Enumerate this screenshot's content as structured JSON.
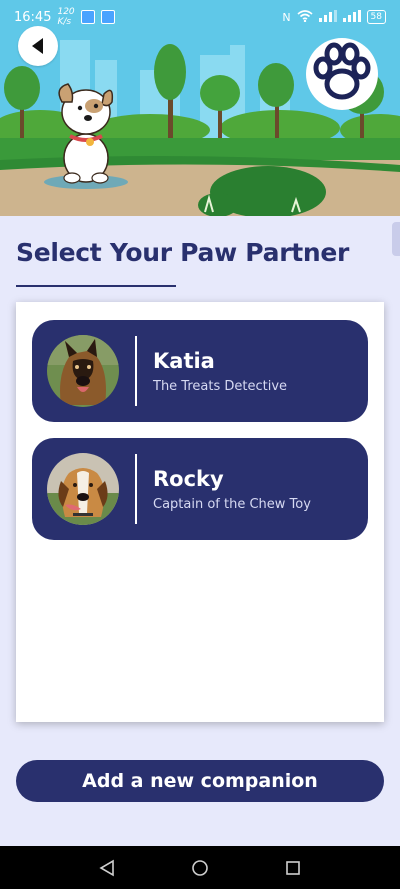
{
  "status_bar": {
    "time": "16:45",
    "speed": "120",
    "speed_unit": "K/s",
    "battery": "58"
  },
  "page": {
    "title": "Select Your Paw Partner"
  },
  "pets": [
    {
      "name": "Katia",
      "subtitle": "The Treats Detective"
    },
    {
      "name": "Rocky",
      "subtitle": "Captain of the Chew Toy"
    }
  ],
  "actions": {
    "add_label": "Add a new companion"
  },
  "colors": {
    "primary": "#29306e",
    "background": "#e7e9fb",
    "sky": "#5fc8e8",
    "grass": "#3a9a3a"
  },
  "icons": {
    "back": "back-arrow-icon",
    "paw": "paw-icon",
    "nav_back": "nav-back-icon",
    "nav_home": "nav-home-icon",
    "nav_recents": "nav-recents-icon"
  }
}
